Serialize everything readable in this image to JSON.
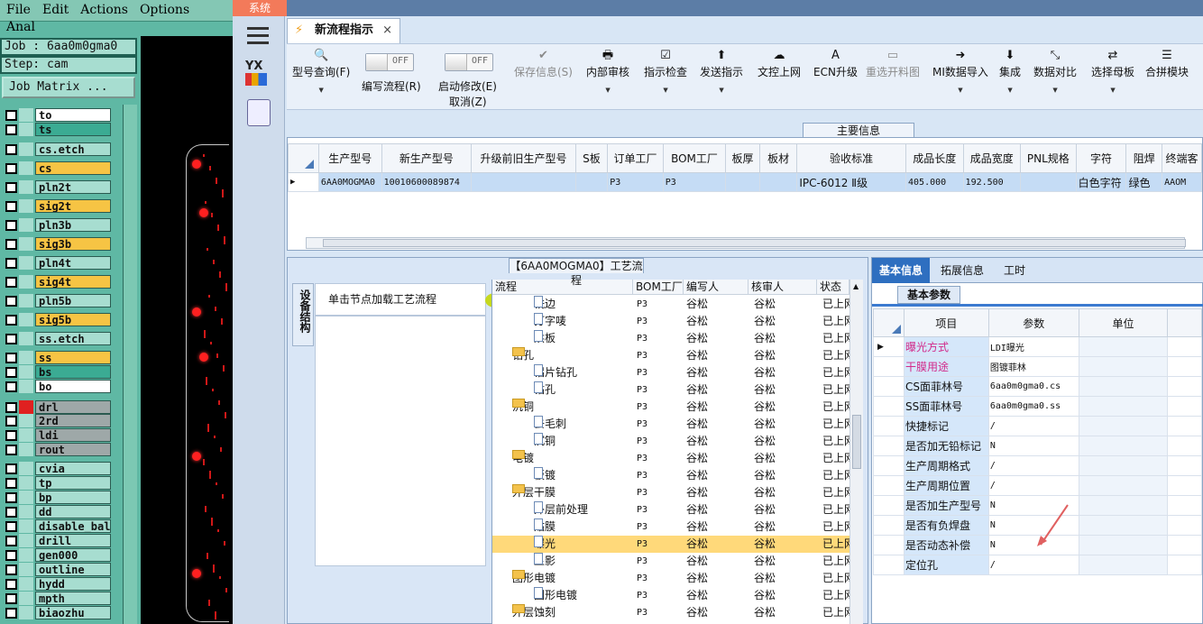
{
  "cam": {
    "menu": [
      "File",
      "Edit",
      "Actions",
      "Options",
      "Anal"
    ],
    "job_label": "Job : 6aa0m0gma0",
    "step_label": "Step: cam",
    "matrix_button": "Job Matrix ...",
    "layers": [
      {
        "name": "to",
        "color": "#ffffff",
        "mark": "#a7ddd0"
      },
      {
        "name": "ts",
        "color": "#3bab93",
        "mark": "#a7ddd0"
      },
      {
        "name": "cs.etch",
        "color": "#a7ddd0",
        "mark": "#a7ddd0"
      },
      {
        "name": "cs",
        "color": "#f6c444",
        "mark": "#a7ddd0"
      },
      {
        "name": "pln2t",
        "color": "#a7ddd0",
        "mark": "#a7ddd0"
      },
      {
        "name": "sig2t",
        "color": "#f6c444",
        "mark": "#a7ddd0"
      },
      {
        "name": "pln3b",
        "color": "#a7ddd0",
        "mark": "#a7ddd0"
      },
      {
        "name": "sig3b",
        "color": "#f6c444",
        "mark": "#a7ddd0"
      },
      {
        "name": "pln4t",
        "color": "#a7ddd0",
        "mark": "#a7ddd0"
      },
      {
        "name": "sig4t",
        "color": "#f6c444",
        "mark": "#a7ddd0"
      },
      {
        "name": "pln5b",
        "color": "#a7ddd0",
        "mark": "#a7ddd0"
      },
      {
        "name": "sig5b",
        "color": "#f6c444",
        "mark": "#a7ddd0"
      },
      {
        "name": "ss.etch",
        "color": "#a7ddd0",
        "mark": "#a7ddd0"
      },
      {
        "name": "ss",
        "color": "#f6c444",
        "mark": "#a7ddd0"
      },
      {
        "name": "bs",
        "color": "#3bab93",
        "mark": "#a7ddd0"
      },
      {
        "name": "bo",
        "color": "#ffffff",
        "mark": "#a7ddd0"
      },
      {
        "name": "drl",
        "color": "#9ea8a8",
        "mark": "#e02020"
      },
      {
        "name": "2rd",
        "color": "#9ea8a8",
        "mark": "#a7ddd0"
      },
      {
        "name": "ldi",
        "color": "#9ea8a8",
        "mark": "#a7ddd0"
      },
      {
        "name": "rout",
        "color": "#9ea8a8",
        "mark": "#a7ddd0"
      },
      {
        "name": "cvia",
        "color": "#a7ddd0",
        "mark": "#a7ddd0"
      },
      {
        "name": "tp",
        "color": "#a7ddd0",
        "mark": "#a7ddd0"
      },
      {
        "name": "bp",
        "color": "#a7ddd0",
        "mark": "#a7ddd0"
      },
      {
        "name": "dd",
        "color": "#a7ddd0",
        "mark": "#a7ddd0"
      },
      {
        "name": "disable_bala",
        "color": "#a7ddd0",
        "mark": "#a7ddd0"
      },
      {
        "name": "drill",
        "color": "#a7ddd0",
        "mark": "#a7ddd0"
      },
      {
        "name": "gen000",
        "color": "#a7ddd0",
        "mark": "#a7ddd0"
      },
      {
        "name": "outline",
        "color": "#a7ddd0",
        "mark": "#a7ddd0"
      },
      {
        "name": "hydd",
        "color": "#a7ddd0",
        "mark": "#a7ddd0"
      },
      {
        "name": "mpth",
        "color": "#a7ddd0",
        "mark": "#a7ddd0"
      },
      {
        "name": "biaozhu",
        "color": "#a7ddd0",
        "mark": "#a7ddd0"
      }
    ]
  },
  "app": {
    "system_tab": "系统",
    "doc_tab": "新流程指示",
    "toolbar": [
      {
        "label": "型号查询(F)",
        "icon": "🔍",
        "dd": true,
        "dis": false
      },
      {
        "label": "保存信息(S)",
        "icon": "✔",
        "dd": false,
        "dis": true
      },
      {
        "label": "内部审核",
        "icon": "🖶",
        "dd": true,
        "dis": false
      },
      {
        "label": "指示检查",
        "icon": "☑",
        "dd": true,
        "dis": false
      },
      {
        "label": "发送指示",
        "icon": "⬆",
        "dd": true,
        "dis": false
      },
      {
        "label": "文控上网",
        "icon": "☁",
        "dd": false,
        "dis": false
      },
      {
        "label": "ECN升级",
        "icon": "A",
        "dd": false,
        "dis": false
      },
      {
        "label": "重选开料图",
        "icon": "▭",
        "dd": false,
        "dis": true
      },
      {
        "label": "MI数据导入",
        "icon": "➜",
        "dd": true,
        "dis": false
      },
      {
        "label": "集成",
        "icon": "⬇",
        "dd": true,
        "dis": false
      },
      {
        "label": "数据对比",
        "icon": "⤡",
        "dd": true,
        "dis": false
      },
      {
        "label": "选择母板",
        "icon": "⇄",
        "dd": true,
        "dis": false
      },
      {
        "label": "合拼模块",
        "icon": "☰",
        "dd": false,
        "dis": false
      }
    ],
    "toggle1": {
      "state": "OFF",
      "label": "编写流程(R)"
    },
    "toggle2": {
      "state": "OFF",
      "label1": "启动修改(E)",
      "label2": "取消(Z)"
    },
    "main_info_title": "主要信息",
    "main_table": {
      "headers": [
        "生产型号",
        "新生产型号",
        "升级前旧生产型号",
        "S板",
        "订单工厂",
        "BOM工厂",
        "板厚",
        "板材",
        "验收标准",
        "成品长度",
        "成品宽度",
        "PNL规格",
        "字符",
        "阻焊",
        "终端客"
      ],
      "row": [
        "6AA0MOGMA0",
        "10010600089874",
        "",
        "",
        "P3",
        "P3",
        "",
        "",
        "IPC-6012 Ⅱ级",
        "405.000",
        "192.500",
        "",
        "白色字符",
        "绿色",
        "AAOM"
      ]
    },
    "flow_title": "【6AA0MOGMA0】工艺流程",
    "vertical_tab": "设备结构",
    "hint": "单击节点加载工艺流程",
    "tree_headers": [
      "流程",
      "BOM工厂",
      "编写人",
      "核审人",
      "状态"
    ],
    "tree_rows": [
      {
        "name": "铣边",
        "level": 2,
        "type": "file",
        "bom": "P3",
        "writer": "谷松",
        "checker": "谷松",
        "status": "已上网"
      },
      {
        "name": "打字唛",
        "level": 2,
        "type": "file",
        "bom": "P3",
        "writer": "谷松",
        "checker": "谷松",
        "status": "已上网"
      },
      {
        "name": "烘板",
        "level": 2,
        "type": "file",
        "bom": "P3",
        "writer": "谷松",
        "checker": "谷松",
        "status": "已上网"
      },
      {
        "name": "钻孔",
        "level": 1,
        "type": "folder",
        "bom": "P3",
        "writer": "谷松",
        "checker": "谷松",
        "status": "已上网"
      },
      {
        "name": "铝片钻孔",
        "level": 2,
        "type": "file",
        "bom": "P3",
        "writer": "谷松",
        "checker": "谷松",
        "status": "已上网"
      },
      {
        "name": "钻孔",
        "level": 2,
        "type": "file",
        "bom": "P3",
        "writer": "谷松",
        "checker": "谷松",
        "status": "已上网"
      },
      {
        "name": "沉铜",
        "level": 1,
        "type": "folder",
        "bom": "P3",
        "writer": "谷松",
        "checker": "谷松",
        "status": "已上网"
      },
      {
        "name": "去毛刺",
        "level": 2,
        "type": "file",
        "bom": "P3",
        "writer": "谷松",
        "checker": "谷松",
        "status": "已上网"
      },
      {
        "name": "沉铜",
        "level": 2,
        "type": "file",
        "bom": "P3",
        "writer": "谷松",
        "checker": "谷松",
        "status": "已上网"
      },
      {
        "name": "电镀",
        "level": 1,
        "type": "folder",
        "bom": "P3",
        "writer": "谷松",
        "checker": "谷松",
        "status": "已上网"
      },
      {
        "name": "板镀",
        "level": 2,
        "type": "file",
        "bom": "P3",
        "writer": "谷松",
        "checker": "谷松",
        "status": "已上网"
      },
      {
        "name": "外层干膜",
        "level": 1,
        "type": "folder",
        "bom": "P3",
        "writer": "谷松",
        "checker": "谷松",
        "status": "已上网"
      },
      {
        "name": "外层前处理",
        "level": 2,
        "type": "file",
        "bom": "P3",
        "writer": "谷松",
        "checker": "谷松",
        "status": "已上网"
      },
      {
        "name": "贴膜",
        "level": 2,
        "type": "file",
        "bom": "P3",
        "writer": "谷松",
        "checker": "谷松",
        "status": "已上网"
      },
      {
        "name": "曝光",
        "level": 2,
        "type": "file",
        "bom": "P3",
        "writer": "谷松",
        "checker": "谷松",
        "status": "已上网",
        "selected": true
      },
      {
        "name": "显影",
        "level": 2,
        "type": "file",
        "bom": "P3",
        "writer": "谷松",
        "checker": "谷松",
        "status": "已上网"
      },
      {
        "name": "图形电镀",
        "level": 1,
        "type": "folder",
        "bom": "P3",
        "writer": "谷松",
        "checker": "谷松",
        "status": "已上网"
      },
      {
        "name": "图形电镀",
        "level": 2,
        "type": "file",
        "bom": "P3",
        "writer": "谷松",
        "checker": "谷松",
        "status": "已上网"
      },
      {
        "name": "外层蚀刻",
        "level": 1,
        "type": "folder",
        "bom": "P3",
        "writer": "谷松",
        "checker": "谷松",
        "status": "已上网"
      }
    ],
    "info_tabs": [
      "基本信息",
      "拓展信息",
      "工时"
    ],
    "sub_tab": "基本参数",
    "param_headers": [
      "项目",
      "参数",
      "单位"
    ],
    "params": [
      {
        "item": "曝光方式",
        "value": "LDI曝光",
        "pink": true
      },
      {
        "item": "干膜用途",
        "value": "图镀菲林",
        "pink": true
      },
      {
        "item": "CS面菲林号",
        "value": "6aa0m0gma0.cs",
        "pink": false
      },
      {
        "item": "SS面菲林号",
        "value": "6aa0m0gma0.ss",
        "pink": false
      },
      {
        "item": "快捷标记",
        "value": "/",
        "pink": false
      },
      {
        "item": "是否加无铅标记",
        "value": "N",
        "pink": false
      },
      {
        "item": "生产周期格式",
        "value": "/",
        "pink": false
      },
      {
        "item": "生产周期位置",
        "value": "/",
        "pink": false
      },
      {
        "item": "是否加生产型号",
        "value": "N",
        "pink": false
      },
      {
        "item": "是否有负焊盘",
        "value": "N",
        "pink": false
      },
      {
        "item": "是否动态补偿",
        "value": "N",
        "pink": false
      },
      {
        "item": "定位孔",
        "value": "/",
        "pink": false
      }
    ]
  }
}
